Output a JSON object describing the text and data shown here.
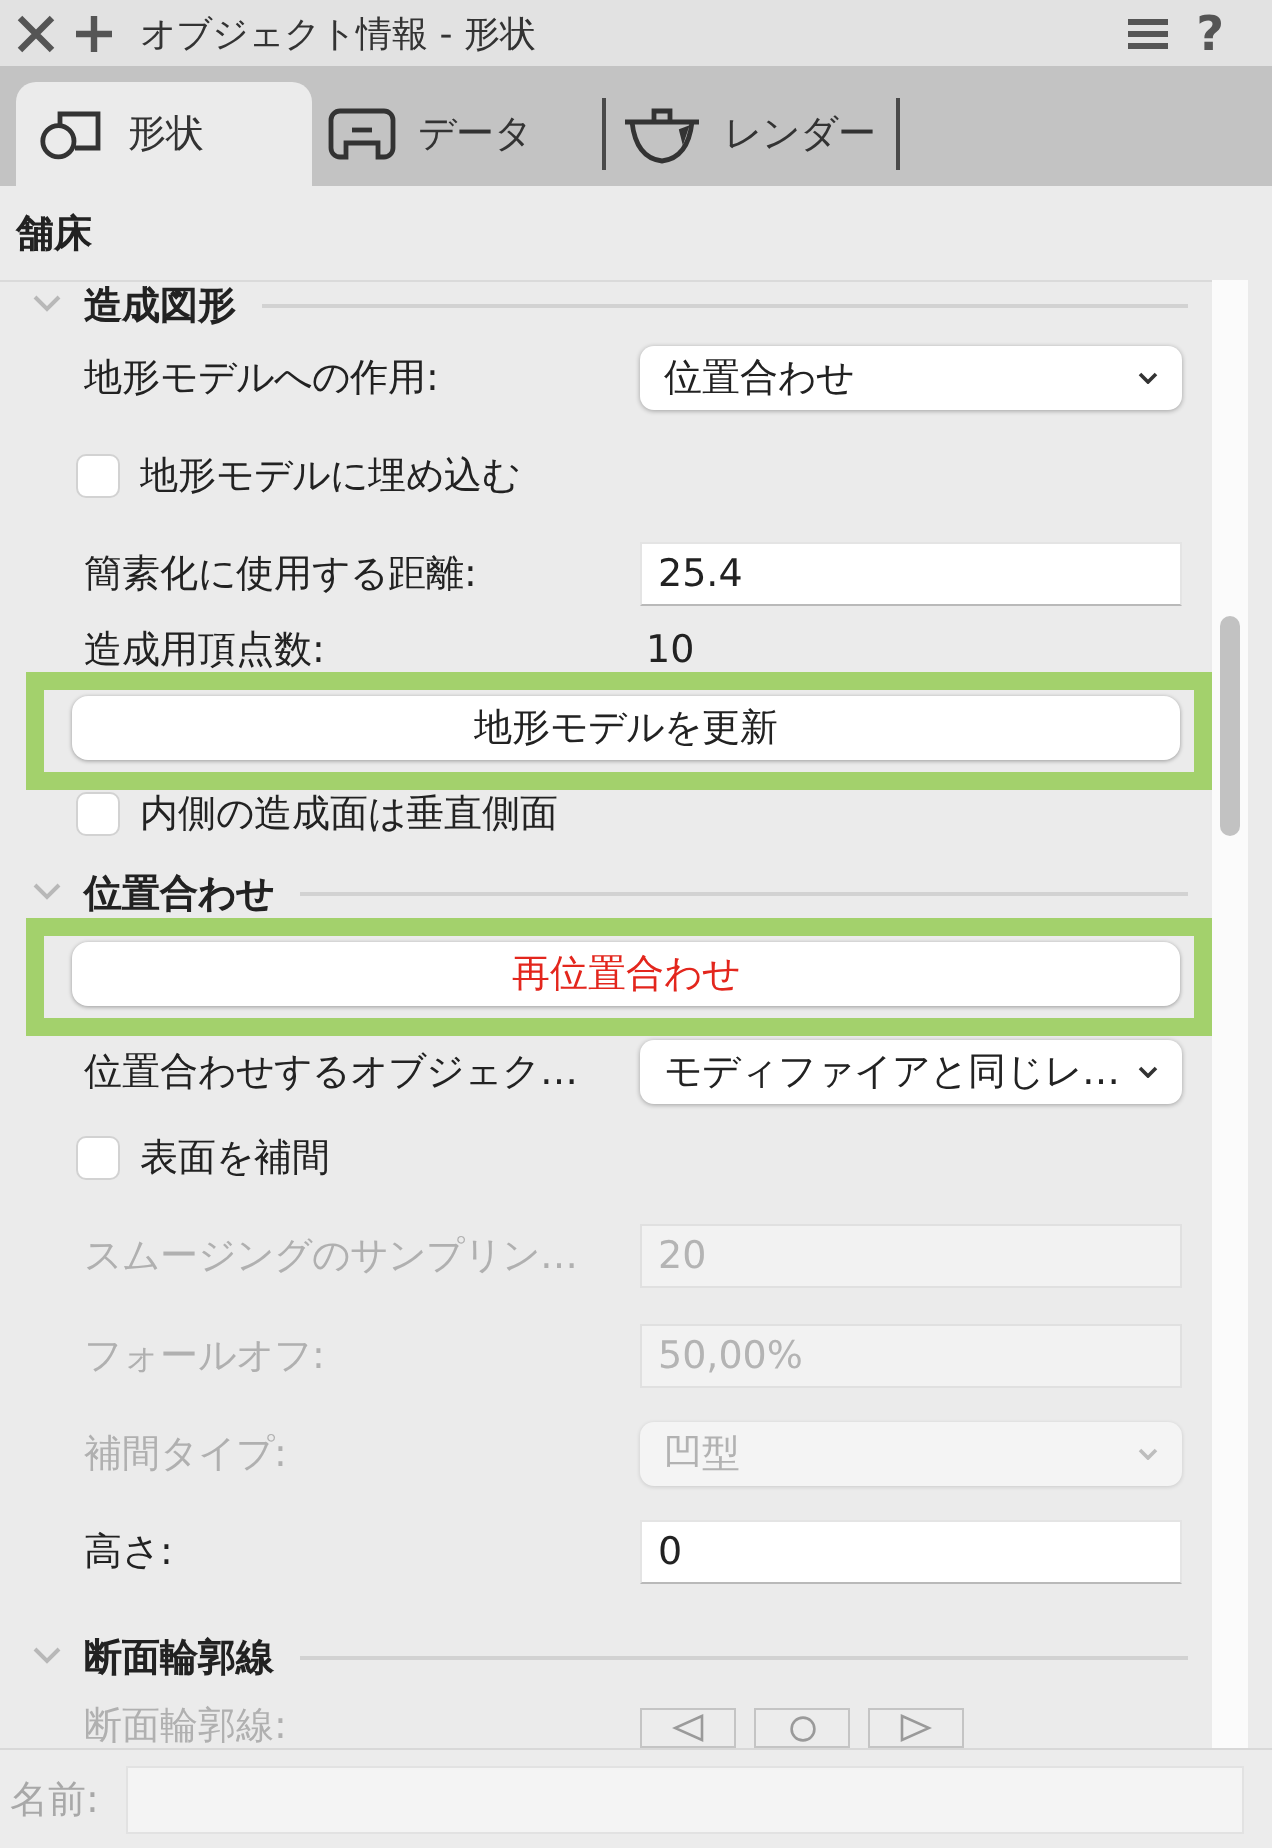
{
  "window": {
    "title": "オブジェクト情報 - 形状",
    "help": "?"
  },
  "tabs": [
    {
      "label": "形状",
      "selected": true
    },
    {
      "label": "データ",
      "selected": false
    },
    {
      "label": "レンダー",
      "selected": false
    }
  ],
  "object_type": "舗床",
  "sections": [
    {
      "title": "造成図形",
      "expanded": true,
      "rows": [
        {
          "kind": "dropdown",
          "label": "地形モデルへの作用:",
          "value": "位置合わせ",
          "disabled": false
        },
        {
          "kind": "checkbox",
          "label": "地形モデルに埋め込む",
          "checked": false
        },
        {
          "kind": "field",
          "label": "簡素化に使用する距離:",
          "value": "25.4",
          "disabled": false
        },
        {
          "kind": "readout",
          "label": "造成用頂点数:",
          "value": "10"
        },
        {
          "kind": "button",
          "label": "地形モデルを更新",
          "highlighted": true,
          "warning": false
        },
        {
          "kind": "checkbox",
          "label": "内側の造成面は垂直側面",
          "checked": false
        }
      ]
    },
    {
      "title": "位置合わせ",
      "expanded": true,
      "rows": [
        {
          "kind": "button",
          "label": "再位置合わせ",
          "highlighted": true,
          "warning": true
        },
        {
          "kind": "dropdown",
          "label": "位置合わせするオブジェク…",
          "value": "モディファイアと同じレ…",
          "disabled": false
        },
        {
          "kind": "checkbox",
          "label": "表面を補間",
          "checked": false
        },
        {
          "kind": "field",
          "label": "スムージングのサンプリン…",
          "value": "20",
          "disabled": true
        },
        {
          "kind": "field",
          "label": "フォールオフ:",
          "value": "50,00%",
          "disabled": true
        },
        {
          "kind": "dropdown",
          "label": "補間タイプ:",
          "value": "凹型",
          "disabled": true
        },
        {
          "kind": "field",
          "label": "高さ:",
          "value": "0",
          "disabled": false
        }
      ]
    },
    {
      "title": "断面輪郭線",
      "expanded": true,
      "rows": [
        {
          "kind": "icon_buttons",
          "label": "断面輪郭線:",
          "disabled": true
        }
      ]
    }
  ],
  "name_field": {
    "label": "名前:",
    "disabled": true
  }
}
